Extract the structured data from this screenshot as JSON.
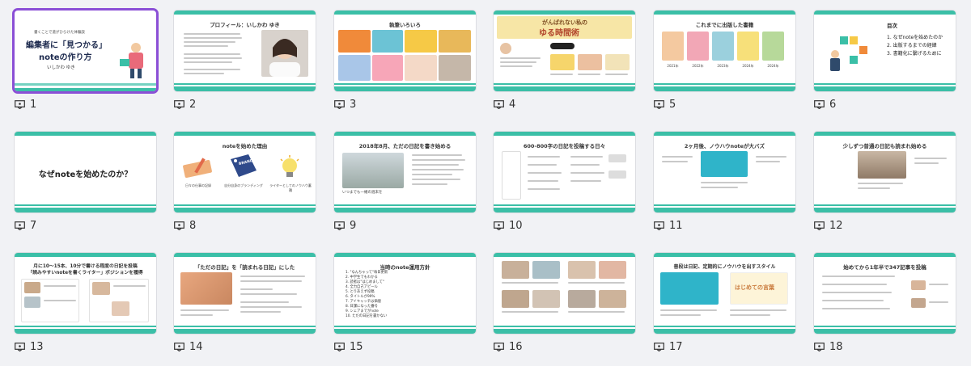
{
  "slides": [
    {
      "num": "1",
      "subtitle": "書くことで道がひらけた体験談",
      "title1": "編集者に「見つかる」",
      "title2": "noteの作り方",
      "author": "いしかわ ゆき"
    },
    {
      "num": "2",
      "title": "プロフィール：いしかわ ゆき"
    },
    {
      "num": "3",
      "title": "執筆いろいろ"
    },
    {
      "num": "4",
      "title": "がんばれない私の",
      "title2": "ゆる時間術"
    },
    {
      "num": "5",
      "title": "これまでに出版した書籍",
      "captions": [
        "2021年",
        "2022年",
        "2023年",
        "2024年",
        "2024年"
      ]
    },
    {
      "num": "6",
      "title": "目次",
      "items": [
        "1. なぜnoteを始めたのか",
        "2. 出版するまでの経緯",
        "3. 書籍化に繋げるために"
      ]
    },
    {
      "num": "7",
      "title": "なぜnoteを始めたのか？"
    },
    {
      "num": "8",
      "title": "noteを始めた理由",
      "captions": [
        "日々の仕事の記録",
        "自分自身のブランディング",
        "ライターとしてのノウハウ蓄積"
      ],
      "badge": "BRAND"
    },
    {
      "num": "9",
      "title": "2018年8月、ただの日記を書き始める",
      "caption": "いつまでも一緒の週末を"
    },
    {
      "num": "10",
      "title": "600-800字の日記を投稿する日々"
    },
    {
      "num": "11",
      "title": "2ヶ月後、ノウハウnoteが大バズ"
    },
    {
      "num": "12",
      "title": "少しずつ普通の日記も読まれ始める"
    },
    {
      "num": "13",
      "title1": "月に10〜15本、10分で書ける程度の日記を投稿",
      "title2": "「読みやすいnoteを書くライター」ポジションを獲得"
    },
    {
      "num": "14",
      "title": "「ただの日記」を「読まれる日記」にした"
    },
    {
      "num": "15",
      "title": "当時のnote運用方針",
      "items": [
        "1. \"なんちゃって\"毎日更新",
        "2. 中学生でもわかる",
        "3. 読者は\"はじめまして\"",
        "4. 全力自己アピール",
        "5. とりあえず投稿",
        "6. タイトルが99%",
        "7. アイキャッチは価値",
        "8. 日課になった番号",
        "9. シェアまでがnote",
        "10. ただの日記を書かない"
      ]
    },
    {
      "num": "16",
      "title": ""
    },
    {
      "num": "17",
      "title": "普段は日記、定期的にノウハウを出すスタイル",
      "badge": "はじめての言葉"
    },
    {
      "num": "18",
      "title": "始めてから1年半で347記事を投稿"
    }
  ],
  "colors": {
    "accent": "#3bbfa7",
    "selected": "#8b4fd6"
  },
  "icon": "slide-comment-icon"
}
